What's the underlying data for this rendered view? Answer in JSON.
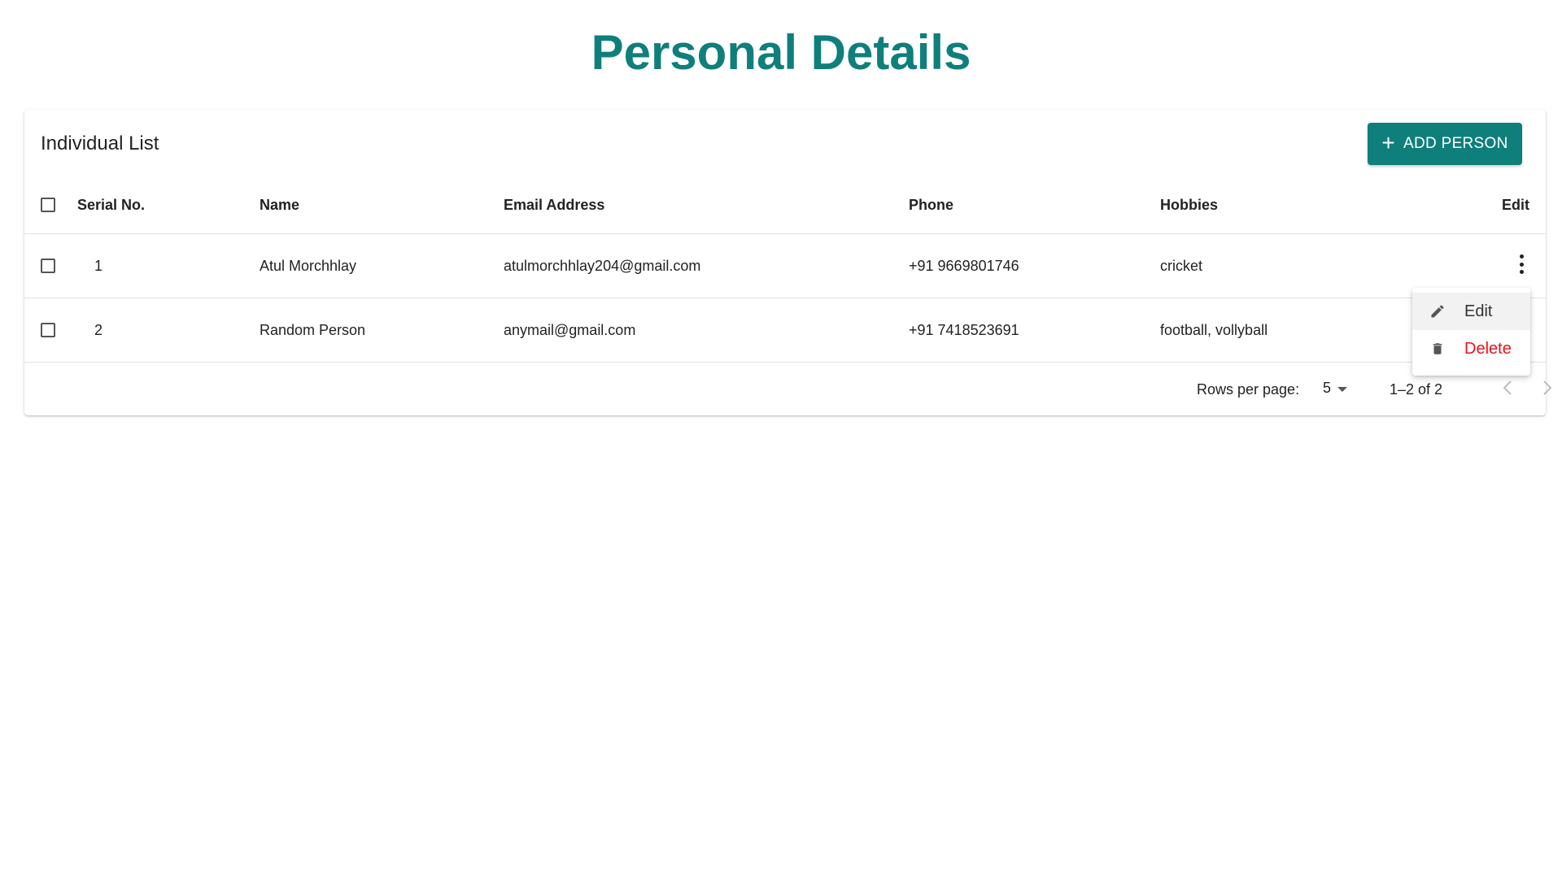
{
  "page": {
    "title": "Personal Details",
    "accent_color": "#0f7f7c",
    "danger_color": "#e8131b"
  },
  "toolbar": {
    "list_title": "Individual List",
    "add_button_label": "ADD PERSON",
    "add_button_icon": "plus-icon"
  },
  "table": {
    "headers": {
      "serial": "Serial No.",
      "name": "Name",
      "email": "Email Address",
      "phone": "Phone",
      "hobbies": "Hobbies",
      "edit": "Edit"
    },
    "rows": [
      {
        "serial": "1",
        "name": "Atul Morchhlay",
        "email": "atulmorchhlay204@gmail.com",
        "phone": "+91 9669801746",
        "hobbies": "cricket",
        "checked": false
      },
      {
        "serial": "2",
        "name": "Random Person",
        "email": "anymail@gmail.com",
        "phone": "+91 7418523691",
        "hobbies": "football, vollyball",
        "checked": false
      }
    ]
  },
  "pagination": {
    "rows_per_page_label": "Rows per page:",
    "rows_per_page_value": "5",
    "range_text": "1–2 of 2",
    "prev_icon": "chevron-left-icon",
    "next_icon": "chevron-right-icon"
  },
  "row_menu": {
    "open_for_row": 1,
    "items": [
      {
        "label": "Edit",
        "icon": "pencil-icon"
      },
      {
        "label": "Delete",
        "icon": "trash-icon"
      }
    ]
  }
}
